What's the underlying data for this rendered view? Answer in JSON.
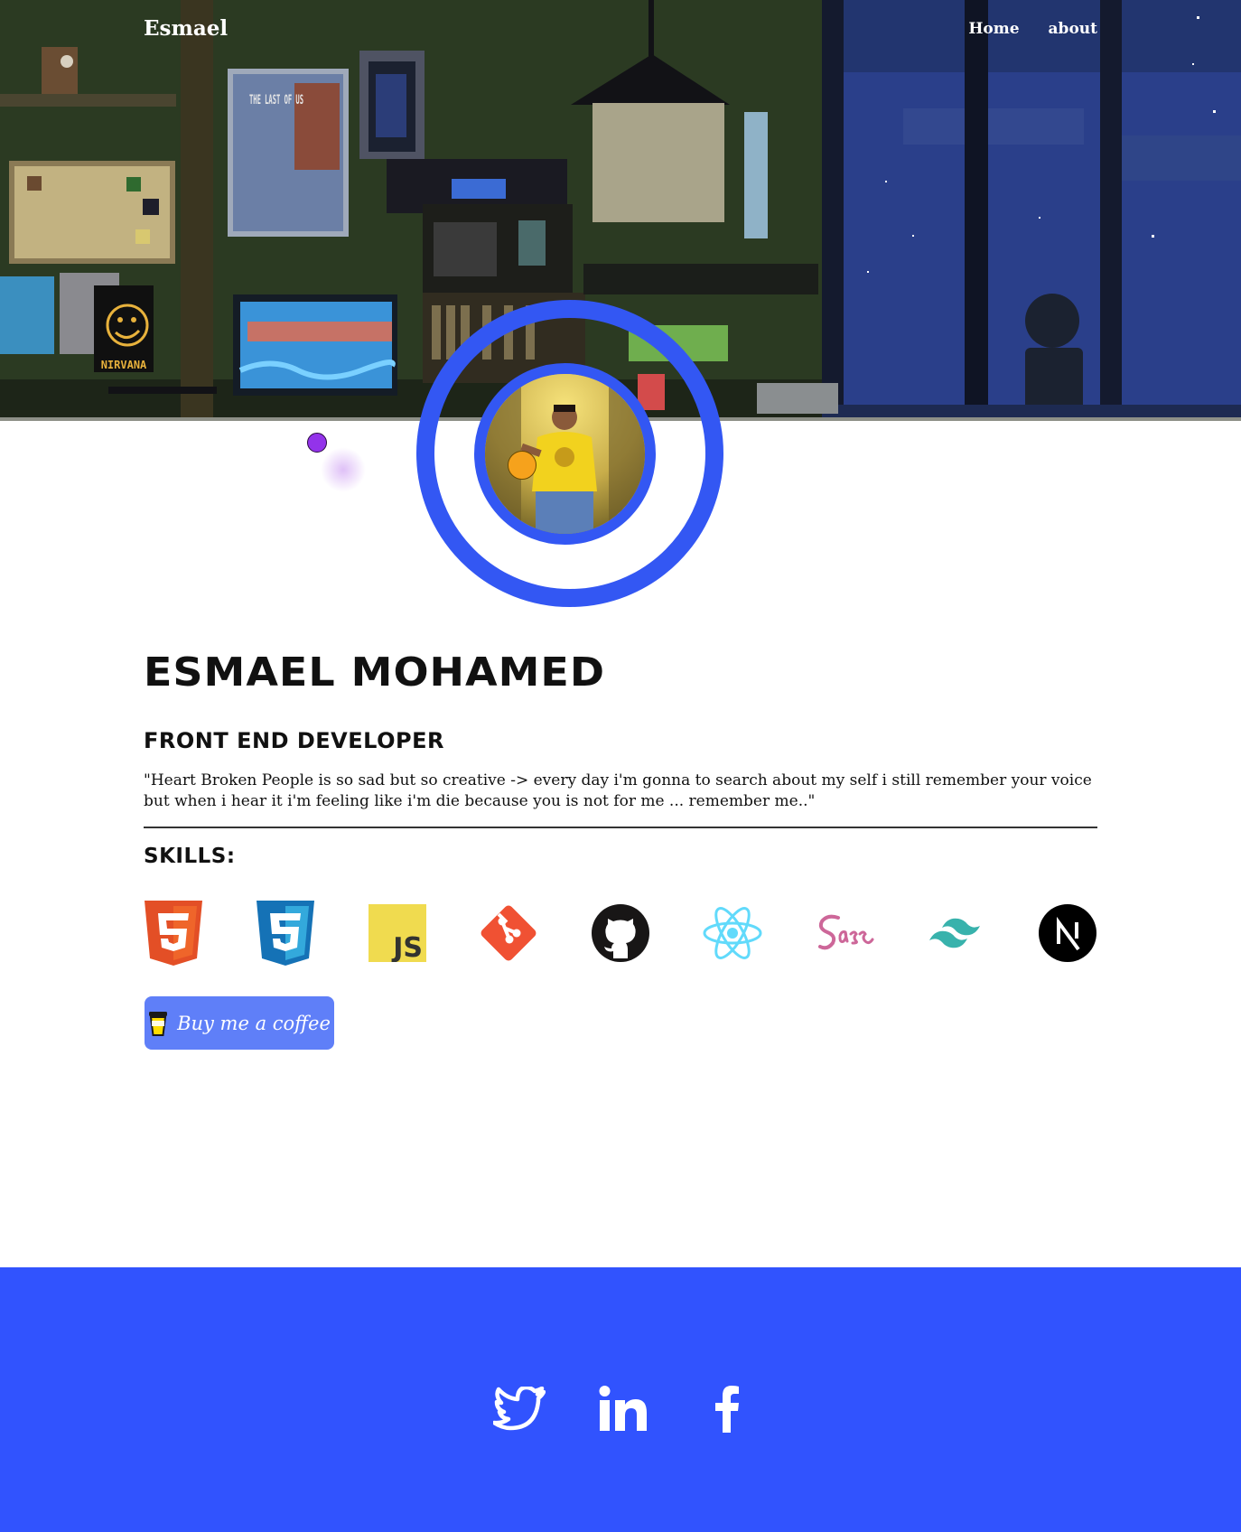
{
  "header": {
    "brand": "Esmael",
    "nav": [
      {
        "label": "Home"
      },
      {
        "label": "about"
      }
    ]
  },
  "hero": {
    "poster_text": "THE LAST OF US",
    "sign_text": "NIRVANA"
  },
  "profile": {
    "name": "Esmael Mohamed",
    "role": "Front end developer",
    "quote": "\"Heart Broken People is so sad but so creative -> every day i'm gonna to search about my self i still remember your voice but when i hear it i'm feeling like i'm die because you is not for me ... remember me..\""
  },
  "skills": {
    "title": "Skills:",
    "items": [
      {
        "name": "html5-icon"
      },
      {
        "name": "css3-icon"
      },
      {
        "name": "javascript-icon"
      },
      {
        "name": "git-icon"
      },
      {
        "name": "github-icon"
      },
      {
        "name": "react-icon"
      },
      {
        "name": "sass-icon"
      },
      {
        "name": "tailwind-icon"
      },
      {
        "name": "nextjs-icon"
      }
    ],
    "js_label": "JS"
  },
  "coffee_button": {
    "label": "Buy me a coffee"
  },
  "footer": {
    "social": [
      {
        "name": "twitter-icon"
      },
      {
        "name": "linkedin-icon"
      },
      {
        "name": "facebook-icon"
      }
    ]
  },
  "colors": {
    "accent": "#3357f3",
    "footer_bg": "#3153fe",
    "coffee_bg": "#5f7ff8"
  }
}
